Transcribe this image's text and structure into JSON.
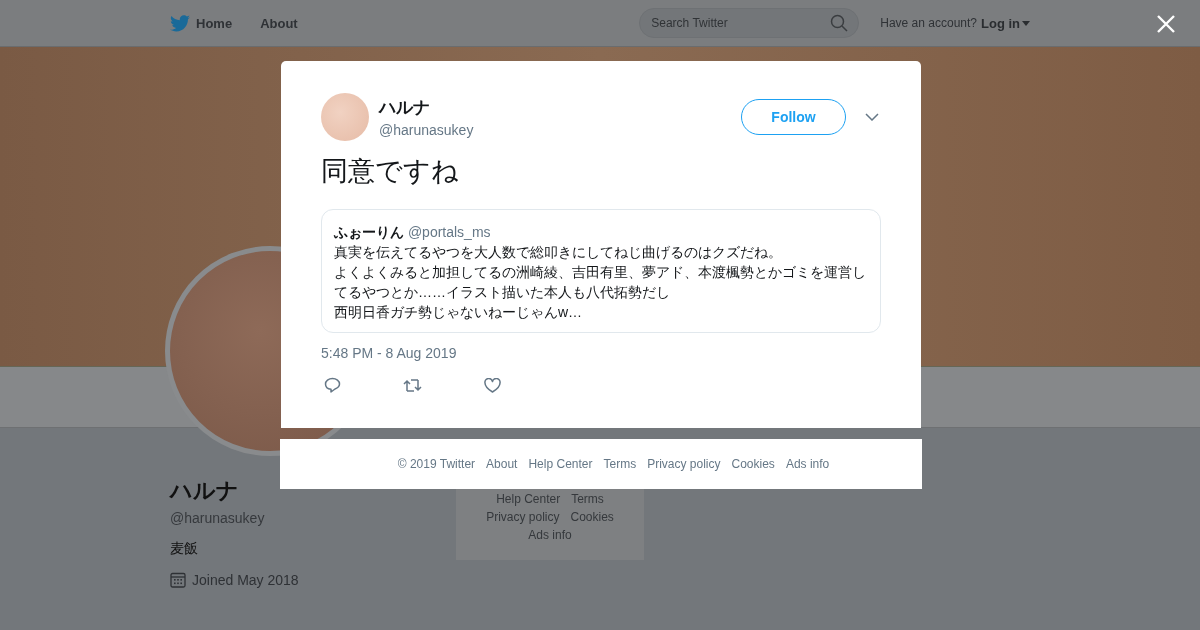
{
  "top_nav": {
    "links": [
      {
        "label": "Home",
        "kind": "home"
      },
      {
        "label": "About",
        "kind": "plain"
      }
    ],
    "search": {
      "placeholder": "Search Twitter"
    },
    "account_prompt": "Have an account?",
    "login": "Log in"
  },
  "profile": {
    "name": "ハルナ",
    "handle": "@harunasukey",
    "bio": "麦飯",
    "joined": "Joined May 2018"
  },
  "background_footer": [
    [
      "Help Center",
      "Terms"
    ],
    [
      "Privacy policy",
      "Cookies"
    ],
    [
      "Ads info"
    ]
  ],
  "tweet": {
    "name": "ハルナ",
    "handle": "@harunasukey",
    "follow": "Follow",
    "text": "同意ですね",
    "quoted": {
      "name": "ふぉーりん",
      "handle": "@portals_ms",
      "lines": [
        "真実を伝えてるやつを大人数で総叩きにしてねじ曲げるのはクズだね。",
        "よくよくみると加担してるの洲崎綾、吉田有里、夢アド、本渡楓勢とかゴミを運営してるやつとか……イラスト描いた本人も八代拓勢だし",
        "西明日香ガチ勢じゃないねーじゃんw…"
      ]
    },
    "timestamp": "5:48 PM - 8 Aug 2019",
    "actions": [
      {
        "kind": "reply"
      },
      {
        "kind": "retweet"
      },
      {
        "kind": "like"
      }
    ]
  },
  "footer_links": [
    "© 2019 Twitter",
    "About",
    "Help Center",
    "Terms",
    "Privacy policy",
    "Cookies",
    "Ads info"
  ]
}
